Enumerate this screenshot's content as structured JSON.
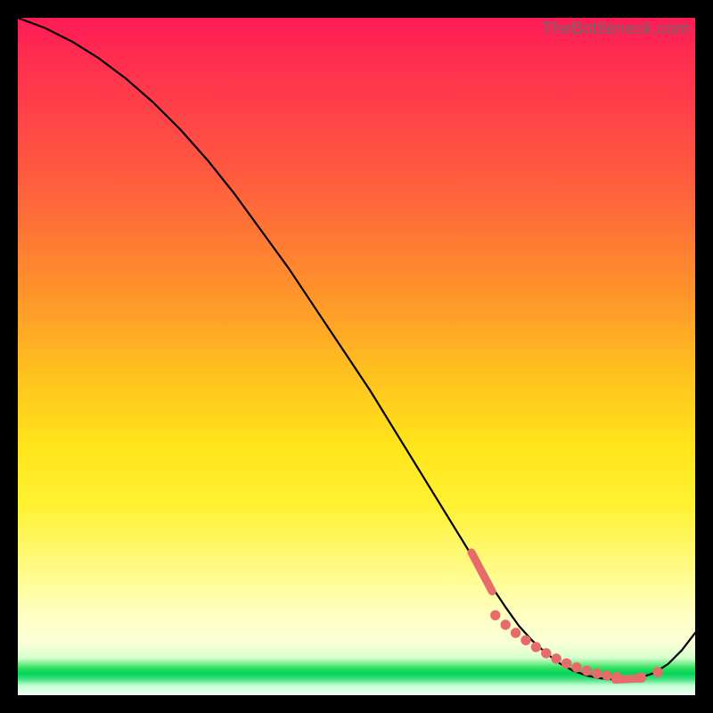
{
  "watermark": "TheBottleneck.com",
  "colors": {
    "dot": "#e86a6a",
    "curve": "#000000"
  },
  "chart_data": {
    "type": "line",
    "title": "",
    "xlabel": "",
    "ylabel": "",
    "xlim": [
      0,
      100
    ],
    "ylim": [
      0,
      100
    ],
    "series": [
      {
        "name": "bottleneck-curve",
        "x": [
          0,
          4,
          8,
          12,
          16,
          20,
          24,
          28,
          32,
          36,
          40,
          44,
          48,
          52,
          56,
          60,
          64,
          68,
          72,
          74,
          76,
          78,
          80,
          82,
          84,
          86,
          88,
          90,
          92,
          94,
          96,
          98,
          100
        ],
        "y": [
          100,
          98.5,
          96.5,
          94,
          91,
          87.5,
          83.5,
          79,
          74,
          68.5,
          63,
          57,
          51,
          45,
          38.5,
          32,
          25.5,
          19,
          13,
          10.2,
          8.0,
          6.2,
          4.7,
          3.6,
          2.9,
          2.5,
          2.3,
          2.3,
          2.6,
          3.3,
          4.6,
          6.6,
          9.2
        ]
      }
    ],
    "highlight_points": {
      "name": "optimal-range-dots",
      "x": [
        70.5,
        72,
        73.5,
        75,
        76.5,
        78,
        79.5,
        81,
        82.5,
        84,
        85.5,
        87,
        88.5,
        92,
        94.5
      ],
      "y": [
        11.8,
        10.4,
        9.2,
        8.1,
        7.1,
        6.2,
        5.4,
        4.7,
        4.1,
        3.6,
        3.2,
        2.9,
        2.7,
        2.6,
        3.4
      ]
    },
    "highlight_caps": [
      {
        "x": 68.5,
        "y": 18.2,
        "len": 6.5,
        "angle": -62
      },
      {
        "x": 90.2,
        "y": 2.4,
        "len": 4.0,
        "angle": 3
      }
    ]
  }
}
